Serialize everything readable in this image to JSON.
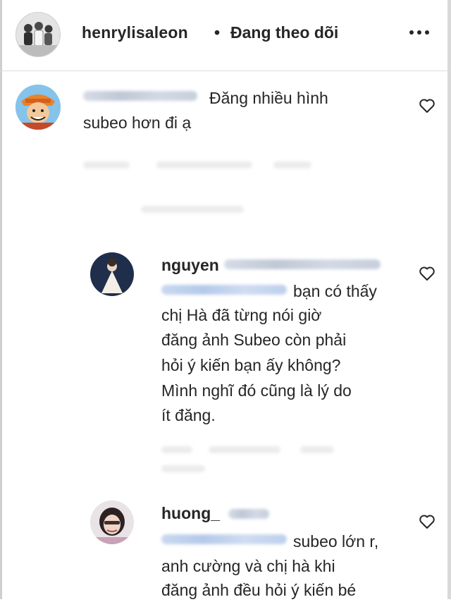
{
  "post_header": {
    "username": "henrylisaleon",
    "separator": "•",
    "follow_status": "Đang theo dõi",
    "more_icon": "more-horizontal-icon"
  },
  "comments": [
    {
      "text_line1": "Đăng nhiều hình",
      "text_line2": "subeo hơn đi ạ",
      "like_icon": "heart-icon"
    },
    {
      "username": "nguyen",
      "text_line1": "bạn có thấy",
      "text_line2": "chị Hà đã từng nói giờ",
      "text_line3": "đăng ảnh Subeo còn phải",
      "text_line4": "hỏi ý kiến bạn ấy không?",
      "text_line5": "Mình nghĩ đó cũng là lý do",
      "text_line6": "ít đăng.",
      "like_icon": "heart-icon"
    },
    {
      "username": "huong_",
      "text_line1": "subeo lớn r,",
      "text_line2": "anh cường và chị hà khi",
      "text_line3": "đăng ảnh đều hỏi ý kiến bé",
      "like_icon": "heart-icon"
    }
  ],
  "colors": {
    "text": "#262626",
    "divider": "#dbdbdb",
    "background": "#ffffff"
  }
}
